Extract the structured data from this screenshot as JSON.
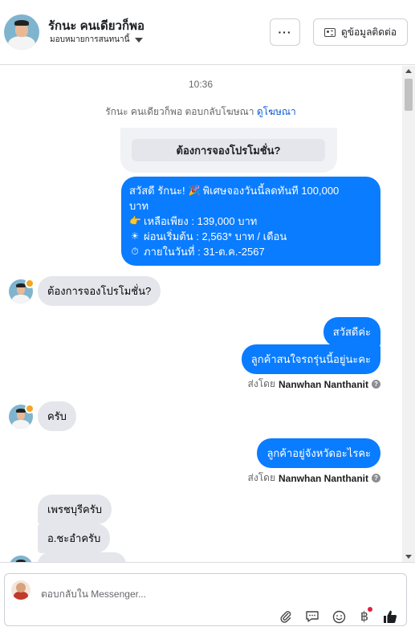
{
  "header": {
    "contact_name": "รักนะ คนเดียวก็พอ",
    "assign_label": "มอบหมายการสนทนานี้",
    "more_label": "···",
    "view_contact_label": "ดูข้อมูลติดต่อ"
  },
  "conversation": {
    "timestamp": "10:36",
    "ad_reply_text": "รักนะ คนเดียวก็พอ ตอบกลับโฆษณา",
    "ad_reply_link": "ดูโฆษณา",
    "ad_button": "ต้องการจองโปรโมชั่น?",
    "promo": {
      "line1_a": "สวัสดี รักนะ!",
      "line1_b": "พิเศษจองวันนี้ลดทันที 100,000",
      "line2": "บาท",
      "line3": "เหลือเพียง : 139,000 บาท",
      "line4": "ผ่อนเริ่มต้น : 2,563* บาท / เดือน",
      "line5": "ภายในวันที่ : 31-ต.ค.-2567"
    },
    "messages": {
      "in1": "ต้องการจองโปรโมชั่น?",
      "out1": "สวัสดีค่ะ",
      "out2": "ลูกค้าสนใจรถรุ่นนี้อยู่นะคะ",
      "sent_by_prefix": "ส่งโดย",
      "sent_by_name": "Nanwhan Nanthanit",
      "in2": "ครับ",
      "out3": "ลูกค้าอยู่จังหวัดอะไรคะ",
      "sent_by_prefix_2": "ส่งโดย",
      "sent_by_name_2": "Nanwhan Nanthanit",
      "in3": "เพรชบุรีครับ",
      "in4": "อ.ชะอำครับ"
    }
  },
  "composer": {
    "placeholder": "ตอบกลับใน Messenger..."
  },
  "colors": {
    "accent": "#0a7cff",
    "incoming_bubble": "#e4e6eb",
    "link": "#0b5cd5"
  },
  "icons": [
    "more-icon",
    "contact-card-icon",
    "caret-down-icon",
    "help-icon",
    "attach-icon",
    "chat-icon",
    "emoji-icon",
    "baht-icon",
    "thumbs-up-icon"
  ]
}
